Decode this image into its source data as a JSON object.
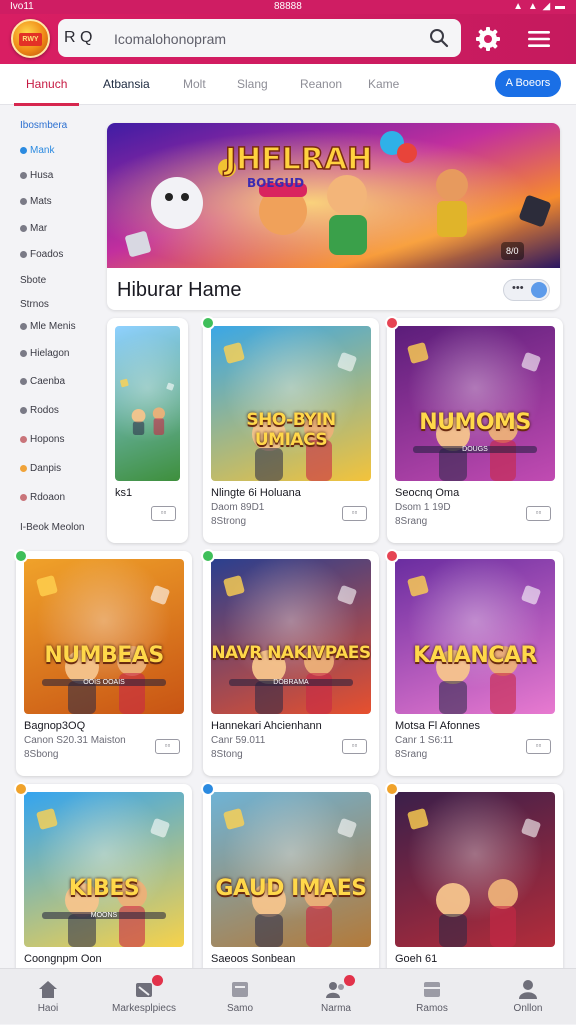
{
  "status_bar": {
    "left": "Ivo11",
    "center": "88888",
    "right": "▲ ▲ ◢ ▬"
  },
  "app_bar": {
    "logo_text": "RWY",
    "search": {
      "lang": "R Q",
      "query": "Icomalohonopram"
    },
    "icons": [
      "search-icon",
      "gear-icon",
      "menu-icon"
    ],
    "accent": "#d91e63"
  },
  "tabs": {
    "items": [
      {
        "label": "Hanuch",
        "state": "active"
      },
      {
        "label": "Atbansia",
        "state": "normal"
      },
      {
        "label": "Molt",
        "state": "normal"
      },
      {
        "label": "Slang",
        "state": "normal"
      },
      {
        "label": "Reanon",
        "state": "normal"
      },
      {
        "label": "Kame",
        "state": "normal"
      }
    ],
    "action_label": "A Boeors"
  },
  "sidebar": {
    "items": [
      {
        "label": "Ibosmbera",
        "color": "#2b8ae0"
      },
      {
        "label": "Mank",
        "color": "#2b8ae0"
      },
      {
        "label": "Husa",
        "color": "#8b8b95"
      },
      {
        "label": "Mats",
        "color": "#8b8b95"
      },
      {
        "label": "Mar",
        "color": "#8b8b95"
      },
      {
        "label": "Foados",
        "color": "#8b8b95"
      },
      {
        "label": "Sbote",
        "color": ""
      },
      {
        "label": "Strnos",
        "color": ""
      },
      {
        "label": "Mle Menis",
        "color": "#8b8b95"
      },
      {
        "label": "Hielagon",
        "color": "#8b8b95"
      },
      {
        "label": "Caenba",
        "color": "#8b8b95"
      },
      {
        "label": "Rodos",
        "color": "#8b8b95"
      },
      {
        "label": "Hopons",
        "color": "#c9747a"
      },
      {
        "label": "Danpis",
        "color": "#f0a33a"
      },
      {
        "label": "Rdoaon",
        "color": "#c9747a"
      },
      {
        "label": "I-Beok Meolon",
        "color": ""
      }
    ]
  },
  "hero": {
    "art_title": "JHFLRAH",
    "art_subtitle": "BOEGUD",
    "title": "Hiburar Hame",
    "toggle_dots": "•••",
    "badge": "8/0"
  },
  "cards": [
    {
      "title": "",
      "subtitle": "",
      "name": "ks1",
      "meta1": "",
      "meta2": "",
      "more": "▫▫",
      "corner": "",
      "bg": [
        "#8fd1ff",
        "#3e8f3c"
      ]
    },
    {
      "title": "SHO-BYIN UMIACS",
      "subtitle": "",
      "name": "Nlingte 6i Holuana",
      "meta1": "Daom 89D1",
      "meta2": "8Strong",
      "more": "▫▫",
      "corner": "#3fbf5a",
      "bg": [
        "#3aa7e6",
        "#f3c33b"
      ]
    },
    {
      "title": "NUMOMS",
      "subtitle": "DOUGS",
      "name": "Seocnq Oma",
      "meta1": "Dsom 1 19D",
      "meta2": "8Srang",
      "more": "▫▫",
      "corner": "#e64454",
      "bg": [
        "#5b1d7a",
        "#c14bb2"
      ]
    },
    {
      "title": "NUMBEAS",
      "subtitle": "OOIS OOAIS",
      "name": "Bagnop3OQ",
      "meta1": "Canon S20.31 Maiston",
      "meta2": "8Sbong",
      "more": "▫▫",
      "corner": "#3fbf5a",
      "bg": [
        "#f0a22a",
        "#c85414"
      ]
    },
    {
      "title": "NAVR NAKIVPAES",
      "subtitle": "DOBRAMA",
      "name": "Hannekari Ahcienhann",
      "meta1": "Canr 59.011",
      "meta2": "8Stong",
      "more": "▫▫",
      "corner": "#3fbf5a",
      "bg": [
        "#2a3f8f",
        "#e7502e"
      ]
    },
    {
      "title": "KAIANCAR",
      "subtitle": "",
      "name": "Motsa Fl Afonnes",
      "meta1": "Canr 1 S6:11",
      "meta2": "8Srang",
      "more": "▫▫",
      "corner": "#e64454",
      "bg": [
        "#6a2da0",
        "#e87ad0"
      ]
    },
    {
      "title": "KIBES",
      "subtitle": "MOONS",
      "name": "Coongnpm Oon",
      "meta1": "",
      "meta2": "",
      "more": "",
      "corner": "#f0a22a",
      "bg": [
        "#33a4f0",
        "#f7d24a"
      ]
    },
    {
      "title": "GAUD IMAES",
      "subtitle": "",
      "name": "Saeoos Sonbean",
      "meta1": "",
      "meta2": "",
      "more": "",
      "corner": "#2b8ae0",
      "bg": [
        "#6eb3d6",
        "#b37a3a"
      ]
    },
    {
      "title": "",
      "subtitle": "",
      "name": "Goeh 61",
      "meta1": "",
      "meta2": "",
      "more": "",
      "corner": "#f0a22a",
      "bg": [
        "#3a1f4a",
        "#b32c3a"
      ]
    }
  ],
  "bottom_nav": {
    "items": [
      {
        "label": "Haoi",
        "icon": "home-icon",
        "badge": false
      },
      {
        "label": "Markesplpiecs",
        "icon": "marketplace-icon",
        "badge": true
      },
      {
        "label": "Samo",
        "icon": "store-icon",
        "badge": false
      },
      {
        "label": "Narma",
        "icon": "people-icon",
        "badge": true
      },
      {
        "label": "Ramos",
        "icon": "library-icon",
        "badge": false
      },
      {
        "label": "Onllon",
        "icon": "profile-icon",
        "badge": false
      }
    ]
  }
}
